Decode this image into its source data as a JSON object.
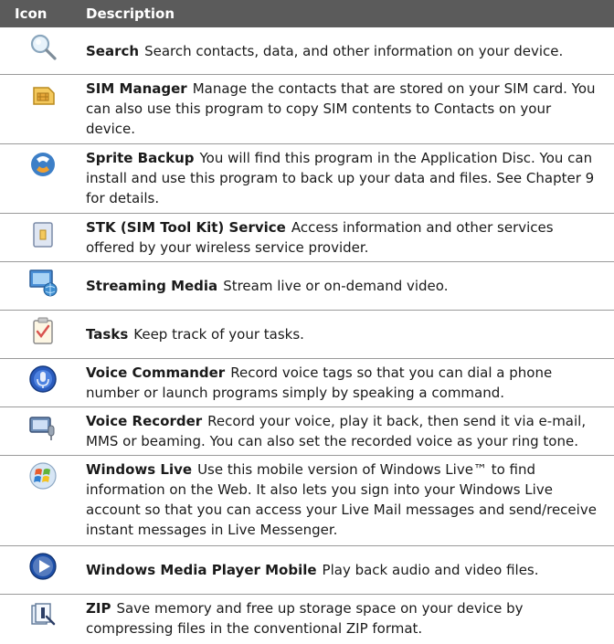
{
  "header": {
    "icon": "Icon",
    "description": "Description"
  },
  "rows": [
    {
      "icon": "search-icon",
      "title": "Search",
      "text": "Search contacts, data, and other information on your device."
    },
    {
      "icon": "sim-manager-icon",
      "title": "SIM Manager",
      "text": "Manage the contacts that are stored on your SIM card. You can also use this program to copy SIM contents to Contacts on your device."
    },
    {
      "icon": "sprite-backup-icon",
      "title": "Sprite Backup",
      "text": "You will find this program in the Application Disc. You can install and use this program to back up your data and files. See Chapter 9 for details."
    },
    {
      "icon": "stk-service-icon",
      "title": "STK (SIM Tool Kit) Service",
      "text": "Access information and other services offered by your wireless service provider."
    },
    {
      "icon": "streaming-media-icon",
      "title": "Streaming Media",
      "text": "Stream live or on-demand video."
    },
    {
      "icon": "tasks-icon",
      "title": "Tasks",
      "text": "Keep track of your tasks."
    },
    {
      "icon": "voice-commander-icon",
      "title": "Voice Commander",
      "text": "Record voice tags so that you can dial a phone number or launch programs simply by speaking a command."
    },
    {
      "icon": "voice-recorder-icon",
      "title": "Voice Recorder",
      "text": "Record your voice, play it back, then send it via e-mail, MMS or beaming. You can also set the recorded voice as your ring tone."
    },
    {
      "icon": "windows-live-icon",
      "title": "Windows Live",
      "text": "Use this mobile version of Windows Live™ to find information on the Web. It also lets you sign into your Windows Live account so that you can access your Live Mail messages and send/receive instant messages in Live Messenger."
    },
    {
      "icon": "windows-media-player-icon",
      "title": "Windows Media Player Mobile",
      "text": "Play back audio and video files."
    },
    {
      "icon": "zip-icon",
      "title": "ZIP",
      "text": "Save memory and free up storage space on your device by compressing files in the conventional ZIP format."
    }
  ]
}
